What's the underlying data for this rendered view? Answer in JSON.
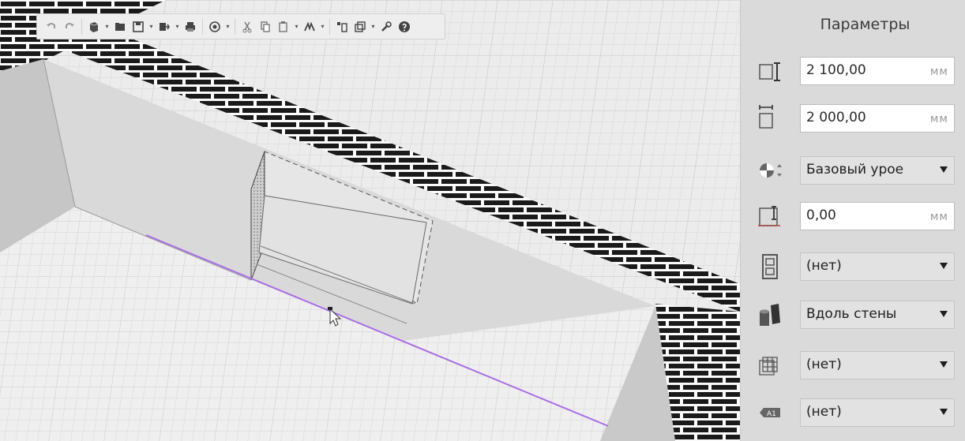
{
  "toolbar": {
    "buttons": [
      {
        "icon": "undo-icon"
      },
      {
        "icon": "redo-icon"
      },
      {
        "icon": "object-3d-icon",
        "dropdown": true
      },
      {
        "icon": "open-folder-icon"
      },
      {
        "icon": "save-icon",
        "dropdown": true
      },
      {
        "icon": "export-icon",
        "dropdown": true
      },
      {
        "icon": "print-icon"
      },
      {
        "icon": "view-orbit-icon",
        "dropdown": true
      },
      {
        "icon": "cut-icon"
      },
      {
        "icon": "copy-icon"
      },
      {
        "icon": "paste-icon",
        "dropdown": true
      },
      {
        "icon": "magic-wand-icon",
        "dropdown": true
      },
      {
        "icon": "layout-icon"
      },
      {
        "icon": "layers-icon",
        "dropdown": true
      },
      {
        "icon": "wrench-icon"
      },
      {
        "icon": "help-icon"
      }
    ]
  },
  "panel": {
    "title": "Параметры",
    "rows": [
      {
        "icon": "height-icon",
        "type": "input",
        "value": "2 100,00",
        "unit": "мм"
      },
      {
        "icon": "width-icon",
        "type": "input",
        "value": "2 000,00",
        "unit": "мм"
      },
      {
        "icon": "level-icon",
        "type": "select",
        "value": "Базовый урое"
      },
      {
        "icon": "offset-icon",
        "type": "input",
        "value": "0,00",
        "unit": "мм"
      },
      {
        "icon": "window-type-icon",
        "type": "select",
        "value": "(нет)"
      },
      {
        "icon": "placement-icon",
        "type": "select",
        "value": "Вдоль стены"
      },
      {
        "icon": "grid-3d-icon",
        "type": "select",
        "value": "(нет)"
      },
      {
        "icon": "label-tag-icon",
        "type": "select",
        "value": "(нет)"
      }
    ]
  },
  "colors": {
    "accent_line": "#a86ee8",
    "panel_bg": "#dadada",
    "viewport_bg": "#e9e9e9"
  }
}
